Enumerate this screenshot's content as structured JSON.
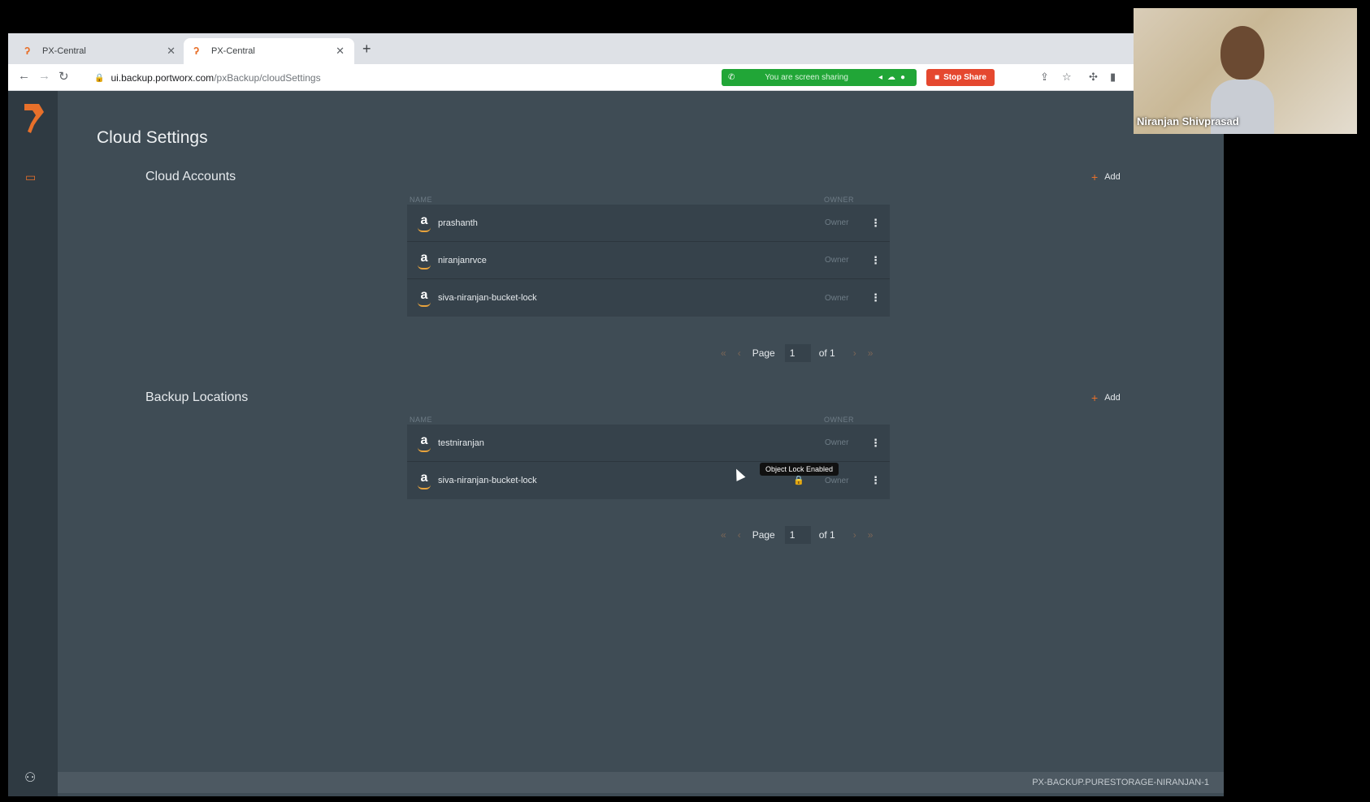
{
  "browser": {
    "tabs": [
      {
        "title": "PX-Central"
      },
      {
        "title": "PX-Central"
      }
    ],
    "url_host": "ui.backup.portworx.com",
    "url_path": "/pxBackup/cloudSettings",
    "screen_share_text": "You are screen sharing",
    "stop_share_label": "Stop Share"
  },
  "page": {
    "title": "Cloud Settings"
  },
  "cloud_accounts": {
    "title": "Cloud Accounts",
    "add_label": "Add",
    "col_name": "NAME",
    "col_owner": "OWNER",
    "rows": [
      {
        "name": "prashanth",
        "owner": "Owner"
      },
      {
        "name": "niranjanrvce",
        "owner": "Owner"
      },
      {
        "name": "siva-niranjan-bucket-lock",
        "owner": "Owner"
      }
    ],
    "pager": {
      "label": "Page",
      "current": "1",
      "of": "of 1"
    }
  },
  "backup_locations": {
    "title": "Backup Locations",
    "add_label": "Add",
    "col_name": "NAME",
    "col_owner": "OWNER",
    "rows": [
      {
        "name": "testniranjan",
        "owner": "Owner"
      },
      {
        "name": "siva-niranjan-bucket-lock",
        "owner": "Owner"
      }
    ],
    "pager": {
      "label": "Page",
      "current": "1",
      "of": "of 1"
    }
  },
  "tooltip": "Object Lock Enabled",
  "footer": "PX-BACKUP.PURESTORAGE-NIRANJAN-1",
  "video": {
    "participant_name": "Niranjan Shivprasad"
  },
  "colors": {
    "accent": "#e8702a",
    "app_bg": "#3f4c55",
    "sidebar_bg": "#2f3a42",
    "share_green": "#21a637",
    "stop_red": "#e5482f"
  }
}
